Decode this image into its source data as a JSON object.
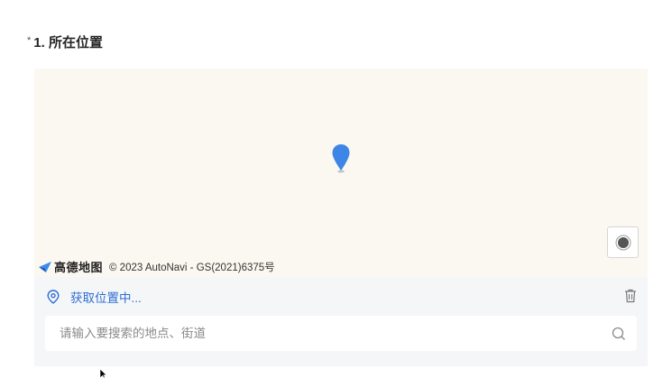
{
  "question": {
    "required_mark": "*",
    "label": "1. 所在位置"
  },
  "map": {
    "logo_text": "高德地图",
    "attribution": "© 2023 AutoNavi - GS(2021)6375号",
    "pin_color": "#3d86e6",
    "background": "#fbf8f1"
  },
  "location": {
    "status_text": "获取位置中...",
    "accent_color": "#2f6fd2"
  },
  "search": {
    "placeholder": "请输入要搜索的地点、街道",
    "value": ""
  },
  "icons": {
    "location": "location-pin-icon",
    "trash": "trash-icon",
    "search": "search-icon",
    "locate": "locate-icon",
    "map_pin": "map-marker-icon"
  }
}
